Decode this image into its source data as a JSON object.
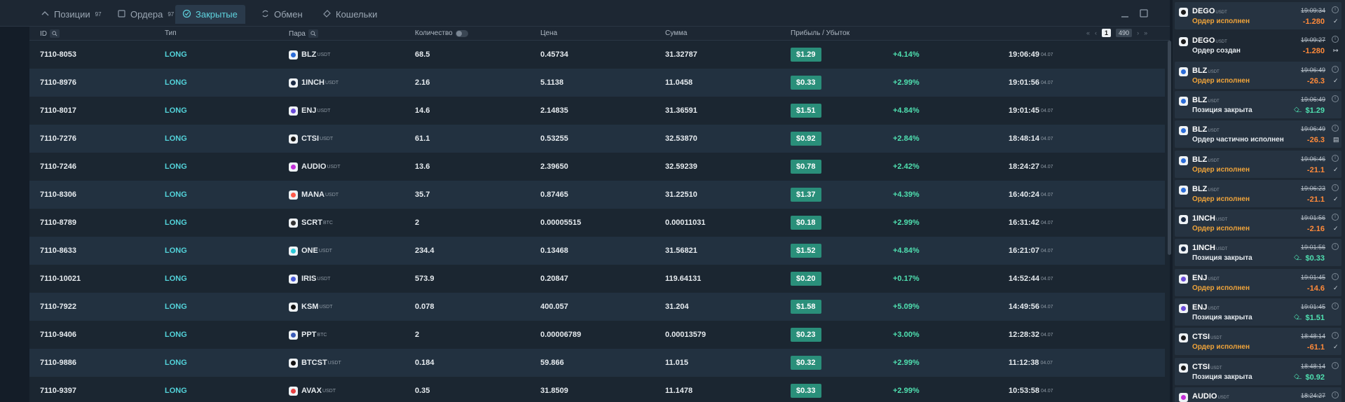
{
  "tabs": [
    {
      "label": "Позиции",
      "count": "97"
    },
    {
      "label": "Ордера",
      "count": "97"
    },
    {
      "label": "Закрытые",
      "count": ""
    },
    {
      "label": "Обмен",
      "count": ""
    },
    {
      "label": "Кошельки",
      "count": ""
    }
  ],
  "columns": {
    "id": "ID",
    "type": "Тип",
    "pair": "Пара",
    "qty": "Количество",
    "price": "Цена",
    "sum": "Сумма",
    "pnl": "Прибыль / Убыток"
  },
  "pagination": {
    "page": "1",
    "total": "490"
  },
  "rows": [
    {
      "id": "7110-8053",
      "type": "LONG",
      "coin": "BLZ",
      "quote": "USDT",
      "color": "#2b6cd8",
      "qty": "68.5",
      "price": "0.45734",
      "sum": "31.32787",
      "pnl": "$1.29",
      "pct": "+4.14%",
      "time": "19:06:49",
      "date": "04.07"
    },
    {
      "id": "7110-8976",
      "type": "LONG",
      "coin": "1INCH",
      "quote": "USDT",
      "color": "#1a2a44",
      "qty": "2.16",
      "price": "5.1138",
      "sum": "11.0458",
      "pnl": "$0.33",
      "pct": "+2.99%",
      "time": "19:01:56",
      "date": "04.07"
    },
    {
      "id": "7110-8017",
      "type": "LONG",
      "coin": "ENJ",
      "quote": "USDT",
      "color": "#6a4bd8",
      "qty": "14.6",
      "price": "2.14835",
      "sum": "31.36591",
      "pnl": "$1.51",
      "pct": "+4.84%",
      "time": "19:01:45",
      "date": "04.07"
    },
    {
      "id": "7110-7276",
      "type": "LONG",
      "coin": "CTSI",
      "quote": "USDT",
      "color": "#1a1a1a",
      "qty": "61.1",
      "price": "0.53255",
      "sum": "32.53870",
      "pnl": "$0.92",
      "pct": "+2.84%",
      "time": "18:48:14",
      "date": "04.07"
    },
    {
      "id": "7110-7246",
      "type": "LONG",
      "coin": "AUDIO",
      "quote": "USDT",
      "color": "#c22fd8",
      "qty": "13.6",
      "price": "2.39650",
      "sum": "32.59239",
      "pnl": "$0.78",
      "pct": "+2.42%",
      "time": "18:24:27",
      "date": "04.07"
    },
    {
      "id": "7110-8306",
      "type": "LONG",
      "coin": "MANA",
      "quote": "USDT",
      "color": "#ff5a4a",
      "qty": "35.7",
      "price": "0.87465",
      "sum": "31.22510",
      "pnl": "$1.37",
      "pct": "+4.39%",
      "time": "16:40:24",
      "date": "04.07"
    },
    {
      "id": "7110-8789",
      "type": "LONG",
      "coin": "SCRT",
      "quote": "BTC",
      "color": "#333333",
      "qty": "2",
      "price": "0.00005515",
      "sum": "0.00011031",
      "pnl": "$0.18",
      "pct": "+2.99%",
      "time": "16:31:42",
      "date": "04.07"
    },
    {
      "id": "7110-8633",
      "type": "LONG",
      "coin": "ONE",
      "quote": "USDT",
      "color": "#2bc8d8",
      "qty": "234.4",
      "price": "0.13468",
      "sum": "31.56821",
      "pnl": "$1.52",
      "pct": "+4.84%",
      "time": "16:21:07",
      "date": "04.07"
    },
    {
      "id": "7110-10021",
      "type": "LONG",
      "coin": "IRIS",
      "quote": "USDT",
      "color": "#4a5bd8",
      "qty": "573.9",
      "price": "0.20847",
      "sum": "119.64131",
      "pnl": "$0.20",
      "pct": "+0.17%",
      "time": "14:52:44",
      "date": "04.07"
    },
    {
      "id": "7110-7922",
      "type": "LONG",
      "coin": "KSM",
      "quote": "USDT",
      "color": "#111111",
      "qty": "0.078",
      "price": "400.057",
      "sum": "31.204",
      "pnl": "$1.58",
      "pct": "+5.09%",
      "time": "14:49:56",
      "date": "04.07"
    },
    {
      "id": "7110-9406",
      "type": "LONG",
      "coin": "PPT",
      "quote": "BTC",
      "color": "#3a5bb8",
      "qty": "2",
      "price": "0.00006789",
      "sum": "0.00013579",
      "pnl": "$0.23",
      "pct": "+3.00%",
      "time": "12:28:32",
      "date": "04.07"
    },
    {
      "id": "7110-9886",
      "type": "LONG",
      "coin": "BTCST",
      "quote": "USDT",
      "color": "#111111",
      "qty": "0.184",
      "price": "59.866",
      "sum": "11.015",
      "pnl": "$0.32",
      "pct": "+2.99%",
      "time": "11:12:38",
      "date": "04.07"
    },
    {
      "id": "7110-9397",
      "type": "LONG",
      "coin": "AVAX",
      "quote": "USDT",
      "color": "#e84142",
      "qty": "0.35",
      "price": "31.8509",
      "sum": "11.1478",
      "pnl": "$0.33",
      "pct": "+2.99%",
      "time": "10:53:58",
      "date": "04.07"
    }
  ],
  "notifications": [
    {
      "coin": "DEGO",
      "quote": "USDT",
      "color": "#1a1a1a",
      "status": "Ордер исполнен",
      "status_color": "orange",
      "time": "19:09:34",
      "value": "-1.280",
      "mark": "✓"
    },
    {
      "coin": "DEGO",
      "quote": "USDT",
      "color": "#1a1a1a",
      "status": "Ордер создан",
      "status_color": "white",
      "time": "19:09:27",
      "value": "-1.280",
      "mark": "↦"
    },
    {
      "coin": "BLZ",
      "quote": "USDT",
      "color": "#2b6cd8",
      "status": "Ордер исполнен",
      "status_color": "orange",
      "time": "19:06:49",
      "value": "-26.3",
      "mark": "✓"
    },
    {
      "coin": "BLZ",
      "quote": "USDT",
      "color": "#2b6cd8",
      "status": "Позиция закрыта",
      "status_color": "white",
      "time": "19:06:49",
      "value": "← $1.29",
      "mark": ""
    },
    {
      "coin": "BLZ",
      "quote": "USDT",
      "color": "#2b6cd8",
      "status": "Ордер частично исполнен",
      "status_color": "white",
      "time": "19:06:49",
      "value": "-26.3",
      "mark": "▤"
    },
    {
      "coin": "BLZ",
      "quote": "USDT",
      "color": "#2b6cd8",
      "status": "Ордер исполнен",
      "status_color": "orange",
      "time": "19:06:46",
      "value": "-21.1",
      "mark": "✓"
    },
    {
      "coin": "BLZ",
      "quote": "USDT",
      "color": "#2b6cd8",
      "status": "Ордер исполнен",
      "status_color": "orange",
      "time": "19:06:23",
      "value": "-21.1",
      "mark": "✓"
    },
    {
      "coin": "1INCH",
      "quote": "USDT",
      "color": "#1a2a44",
      "status": "Ордер исполнен",
      "status_color": "orange",
      "time": "19:01:56",
      "value": "-2.16",
      "mark": "✓"
    },
    {
      "coin": "1INCH",
      "quote": "USDT",
      "color": "#1a2a44",
      "status": "Позиция закрыта",
      "status_color": "white",
      "time": "19:01:56",
      "value": "← $0.33",
      "mark": ""
    },
    {
      "coin": "ENJ",
      "quote": "USDT",
      "color": "#6a4bd8",
      "status": "Ордер исполнен",
      "status_color": "orange",
      "time": "19:01:45",
      "value": "-14.6",
      "mark": "✓"
    },
    {
      "coin": "ENJ",
      "quote": "USDT",
      "color": "#6a4bd8",
      "status": "Позиция закрыта",
      "status_color": "white",
      "time": "19:01:45",
      "value": "← $1.51",
      "mark": ""
    },
    {
      "coin": "CTSI",
      "quote": "USDT",
      "color": "#1a1a1a",
      "status": "Ордер исполнен",
      "status_color": "orange",
      "time": "18:48:14",
      "value": "-61.1",
      "mark": "✓"
    },
    {
      "coin": "CTSI",
      "quote": "USDT",
      "color": "#1a1a1a",
      "status": "Позиция закрыта",
      "status_color": "white",
      "time": "18:48:14",
      "value": "← $0.92",
      "mark": ""
    },
    {
      "coin": "AUDIO",
      "quote": "USDT",
      "color": "#c22fd8",
      "status": "",
      "status_color": "white",
      "time": "18:24:27",
      "value": "",
      "mark": ""
    }
  ]
}
